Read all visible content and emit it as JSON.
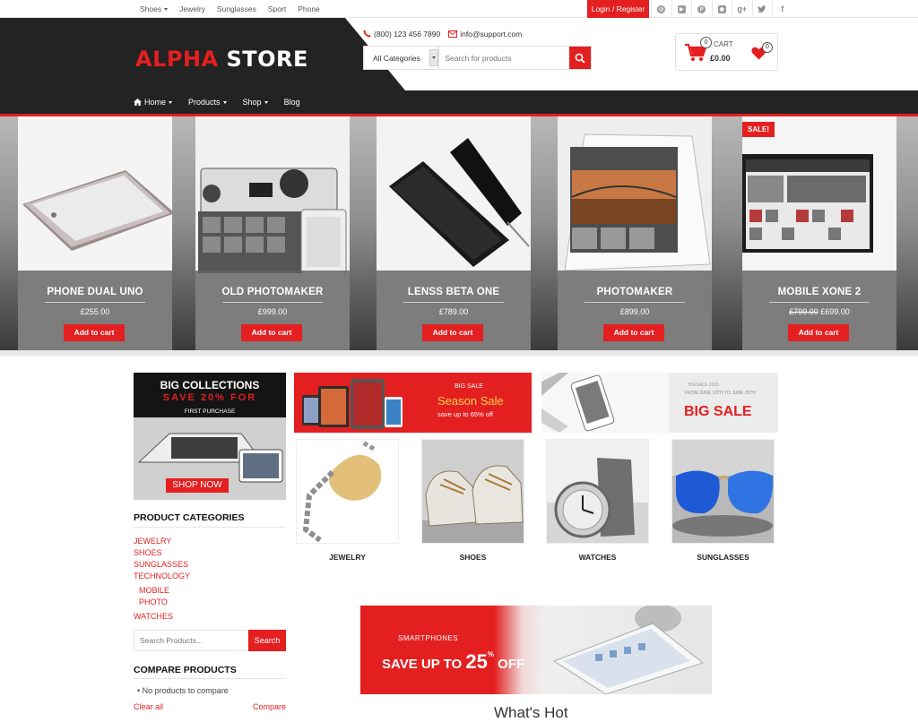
{
  "topbar": {
    "nav": [
      {
        "label": "Shoes",
        "dropdown": true
      },
      {
        "label": "Jewelry",
        "dropdown": false
      },
      {
        "label": "Sunglasses",
        "dropdown": false
      },
      {
        "label": "Sport",
        "dropdown": false
      },
      {
        "label": "Phone",
        "dropdown": false
      }
    ],
    "login_label": "Login / Register",
    "social_icons": [
      "pinterest-alt-icon",
      "youtube-icon",
      "pinterest-icon",
      "instagram-icon",
      "google-plus-icon",
      "twitter-icon",
      "facebook-icon"
    ]
  },
  "header": {
    "logo_part1": "ALPHA",
    "logo_part2": "STORE",
    "phone": "(800) 123 456 7890",
    "email": "info@support.com",
    "category_select": "All Categories",
    "search_placeholder": "Search for products",
    "cart_count": "0",
    "cart_label": "CART",
    "cart_total": "£0.00",
    "wishlist_count": "0"
  },
  "mainnav": [
    {
      "label": "Home",
      "dropdown": true
    },
    {
      "label": "Products",
      "dropdown": true
    },
    {
      "label": "Shop",
      "dropdown": true
    },
    {
      "label": "Blog",
      "dropdown": false
    }
  ],
  "hero_products": [
    {
      "title": "PHONE DUAL UNO",
      "price": "£255.00",
      "old_price": "",
      "button": "Add to cart"
    },
    {
      "title": "OLD PHOTOMAKER",
      "price": "£999.00",
      "old_price": "",
      "button": "Add to cart"
    },
    {
      "title": "LENSS BETA ONE",
      "price": "£789.00",
      "old_price": "",
      "button": "Add to cart"
    },
    {
      "title": "PHOTOMAKER",
      "price": "£899.00",
      "old_price": "",
      "button": "Add to cart"
    },
    {
      "title": "MOBILE XONE 2",
      "price": "£699.00",
      "old_price": "£799.00",
      "button": "Add to cart",
      "badge": "SALE!"
    }
  ],
  "sidebar": {
    "promo": {
      "line1": "BIG COLLECTIONS",
      "line2": "SAVE 20% FOR",
      "line3": "FIRST PURCHASE",
      "button": "SHOP NOW"
    },
    "categories_heading": "PRODUCT CATEGORIES",
    "categories": [
      "JEWELRY",
      "SHOES",
      "SUNGLASSES",
      "TECHNOLOGY"
    ],
    "subcategories": [
      "MOBILE",
      "PHOTO"
    ],
    "last_category": "WATCHES",
    "search_placeholder": "Search Products...",
    "search_button": "Search",
    "compare_heading": "COMPARE PRODUCTS",
    "compare_empty": "No products to compare",
    "clear_all": "Clear all",
    "compare_link": "Compare"
  },
  "banners": {
    "red": {
      "small": "BIG SALE",
      "big": "Season Sale",
      "sub": "save up to 65% off"
    },
    "gray": {
      "small1": "BIGSALE 2015",
      "small2": "FROM JUNE 10TH TO JUNE 25TH",
      "big": "BIG SALE"
    }
  },
  "tiles": [
    "JEWELRY",
    "SHOES",
    "WATCHES",
    "SUNGLASSES"
  ],
  "bottom_banner": {
    "small": "SMARTPHONES",
    "big_prefix": "SAVE UP TO",
    "number": "25",
    "percent": "%",
    "suffix": "OFF"
  },
  "section_title": "What's Hot",
  "colors": {
    "accent": "#e41f20",
    "dark": "#232323"
  }
}
